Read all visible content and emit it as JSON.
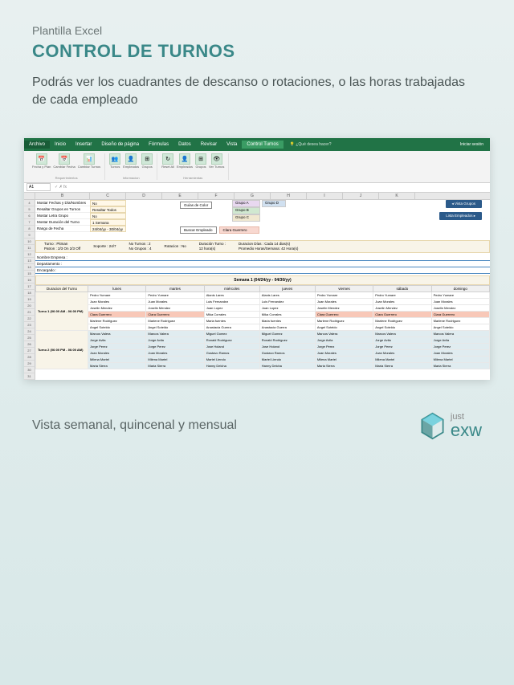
{
  "header": {
    "subtitle": "Plantilla Excel",
    "title": "CONTROL DE TURNOS",
    "description": "Podrás ver los cuadrantes de descanso o rotaciones, o las horas trabajadas de cada empleado"
  },
  "ribbon": {
    "tabs": [
      "Archivo",
      "Inicio",
      "Insertar",
      "Diseño de página",
      "Fórmulas",
      "Datos",
      "Revisar",
      "Vista",
      "Control Turnos"
    ],
    "search": "¿Qué desea hacer?",
    "signin": "Iniciar sesión",
    "groups": {
      "req": {
        "label": "Requerimientos",
        "items": [
          {
            "icon": "📅",
            "label": "Fecha y Plan"
          },
          {
            "icon": "📅",
            "label": "Cambiar Fecha"
          },
          {
            "icon": "📊",
            "label": "Cambiar Turnos"
          }
        ]
      },
      "info": {
        "label": "Informacion",
        "items": [
          {
            "icon": "👥",
            "label": "Turnos"
          },
          {
            "icon": "👤",
            "label": "Empleados"
          },
          {
            "icon": "⊞",
            "label": "Grupos"
          }
        ]
      },
      "tools": {
        "label": "Herramientas",
        "items": [
          {
            "icon": "↻",
            "label": "Reset All"
          },
          {
            "icon": "👤",
            "label": "Empleados"
          },
          {
            "icon": "⊞",
            "label": "Grupos"
          },
          {
            "icon": "👁",
            "label": "Ver Turnos"
          }
        ]
      }
    }
  },
  "formula_bar": {
    "cell": "A1",
    "fx": "fx"
  },
  "columns": [
    "B",
    "C",
    "D",
    "E",
    "F",
    "G",
    "H",
    "I",
    "J",
    "K"
  ],
  "config": [
    {
      "num": "4",
      "label": "Mostar Fechas y Día/Nombres",
      "value": "No"
    },
    {
      "num": "5",
      "label": "Resaltar Grupos en Turnos",
      "value": "Resaltar Todos"
    },
    {
      "num": "6",
      "label": "Mostar Letra Grupo",
      "value": "No"
    },
    {
      "num": "7",
      "label": "Mostar Duración del Turno",
      "value": "1 Semana"
    },
    {
      "num": "8",
      "label": "Rango de Fecha",
      "value": "24/04/yy - 30/04/yy"
    }
  ],
  "color_guide": "Guías de Color",
  "grupos": {
    "a": "Grupo A",
    "b": "Grupo B",
    "c": "Grupo C",
    "d": "Grupo D"
  },
  "buttons": {
    "vista_grupos": "◂ Vista Grupos",
    "lista_empleados": "Lista Empleados ▸",
    "buscar": "Buscar Empleado",
    "buscar_value": "Clara Guerrero"
  },
  "info_bar": {
    "turno": "Turno : Pitman",
    "patron": "Patron : 2/3 On 2/3 Off",
    "soporte": "Soporte : 24/7",
    "no_turnos": "No Turnos : 2",
    "no_grupos": "No Grupos : 4",
    "rotacion": "Rotacion : No",
    "duracion": "Duración Turno :",
    "horas": "12 hora(s)",
    "dias": "Duracion Días : Cada 14 dias(s)",
    "promedio": "Promedio Horas/Semana: 42 Hora(s)"
  },
  "empresa": {
    "nombre": "Nombre Empresa :",
    "depto": "Departamento :",
    "encargado": "Encargado :"
  },
  "week_title": "Semana 1 (04/24/yy - 04/30/yy)",
  "schedule": {
    "header_first": "Duracion del Turno",
    "days": [
      "lunes",
      "martes",
      "miércoles",
      "jueves",
      "viernes",
      "sábado",
      "domingo"
    ],
    "turno1": "Turno 1 (06:00 AM - 06:00 PM)",
    "turno2": "Turno 2 (06:00 PM - 06:00 AM)",
    "rows1": [
      {
        "num": "19",
        "cells": [
          "Pedro Yumare",
          "Pedro Yumare",
          "Alanis Lares",
          "Alanis Lares",
          "Pedro Yumare",
          "Pedro Yumare",
          "Pedro Yumare"
        ]
      },
      {
        "num": "20",
        "cells": [
          "Juan Morales",
          "Juan Morales",
          "Luis Fernandez",
          "Luis Fernandez",
          "Juan Morales",
          "Juan Morales",
          "Juan Morales"
        ]
      },
      {
        "num": "21",
        "cells": [
          "Joselin Mendez",
          "Joselin Mendez",
          "Juan Lopez",
          "Juan Lopez",
          "Joselin Mendez",
          "Joselin Mendez",
          "Joselin Mendez"
        ]
      },
      {
        "num": "22",
        "cells": [
          "Clara Guerrero",
          "Clara Guerrero",
          "Mika Corrales",
          "Mika Corrales",
          "Clara Guerrero",
          "Clara Guerrero",
          "Clara Guerrero"
        ],
        "hl": [
          0,
          1,
          4,
          5,
          6
        ]
      },
      {
        "num": "23",
        "cells": [
          "Marlene Rodriguez",
          "Marlene Rodriguez",
          "Maria fuentes",
          "Maria fuentes",
          "Marlene Rodriguez",
          "Marlene Rodriguez",
          "Marlene Rodriguez"
        ]
      },
      {
        "num": "24",
        "cells": [
          "Angel Soteldo",
          "Angel Soteldo",
          "Anastacia Guerra",
          "Anastacia Guerra",
          "Angel Soteldo",
          "Angel Soteldo",
          "Angel Soteldo"
        ]
      }
    ],
    "rows2": [
      {
        "num": "25",
        "cells": [
          "Marcos Valera",
          "Marcos Valera",
          "Miguel Gomez",
          "Miguel Gomez",
          "Marcos Valera",
          "Marcos Valera",
          "Marcos Valera"
        ]
      },
      {
        "num": "26",
        "cells": [
          "Jorge Avila",
          "Jorge Avila",
          "Ronald Rodriguez",
          "Ronald Rodriguez",
          "Jorge Avila",
          "Jorge Avila",
          "Jorge Avila"
        ]
      },
      {
        "num": "27",
        "cells": [
          "Jorge Perez",
          "Jorge Perez",
          "Jose Holand",
          "Jose Holand",
          "Jorge Perez",
          "Jorge Perez",
          "Jorge Perez"
        ]
      },
      {
        "num": "28",
        "cells": [
          "Joan Morales",
          "Joan Morales",
          "Gustavo Ramos",
          "Gustavo Ramos",
          "Joan Morales",
          "Joan Morales",
          "Joan Morales"
        ]
      },
      {
        "num": "29",
        "cells": [
          "Milena Martel",
          "Milena Martel",
          "Martel Liendo",
          "Martel Liendo",
          "Milena Martel",
          "Milena Martel",
          "Milena Martel"
        ]
      },
      {
        "num": "30",
        "cells": [
          "Maria Sierra",
          "Maria Sierra",
          "Hanny Delcha",
          "Hanny Delcha",
          "Maria Sierra",
          "Maria Sierra",
          "Maria Sierra"
        ]
      }
    ]
  },
  "footer": {
    "text": "Vista semanal, quincenal y mensual",
    "logo_just": "just",
    "logo_exw": "exw"
  },
  "chart_data": {
    "type": "table",
    "title": "Control de Turnos - Semana 1 (04/24/yy - 04/30/yy)",
    "categories": [
      "lunes",
      "martes",
      "miércoles",
      "jueves",
      "viernes",
      "sábado",
      "domingo"
    ],
    "notes": "Employee shift schedule; highlighted employee: Clara Guerrero"
  }
}
